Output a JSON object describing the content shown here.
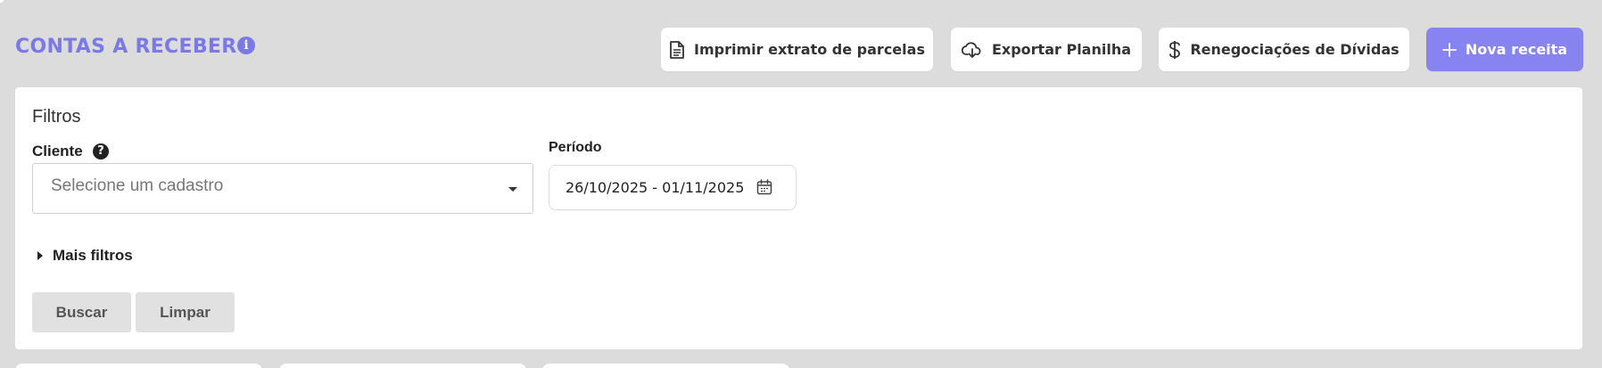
{
  "header": {
    "title": "CONTAS A RECEBER",
    "info_icon": "info-icon",
    "buttons": {
      "print_label": "Imprimir extrato de parcelas",
      "export_label": "Exportar Planilha",
      "reneg_label": "Renegociações de Dívidas",
      "new_label": "Nova receita"
    }
  },
  "filters": {
    "title": "Filtros",
    "cliente": {
      "label": "Cliente",
      "placeholder": "Selecione um cadastro"
    },
    "periodo": {
      "label": "Período",
      "value": "26/10/2025 - 01/11/2025"
    },
    "more_filters_label": "Mais filtros",
    "search_label": "Buscar",
    "clear_label": "Limpar"
  },
  "colors": {
    "accent": "#8784f1",
    "title": "#7b78e8",
    "background": "#dcdcdc"
  }
}
